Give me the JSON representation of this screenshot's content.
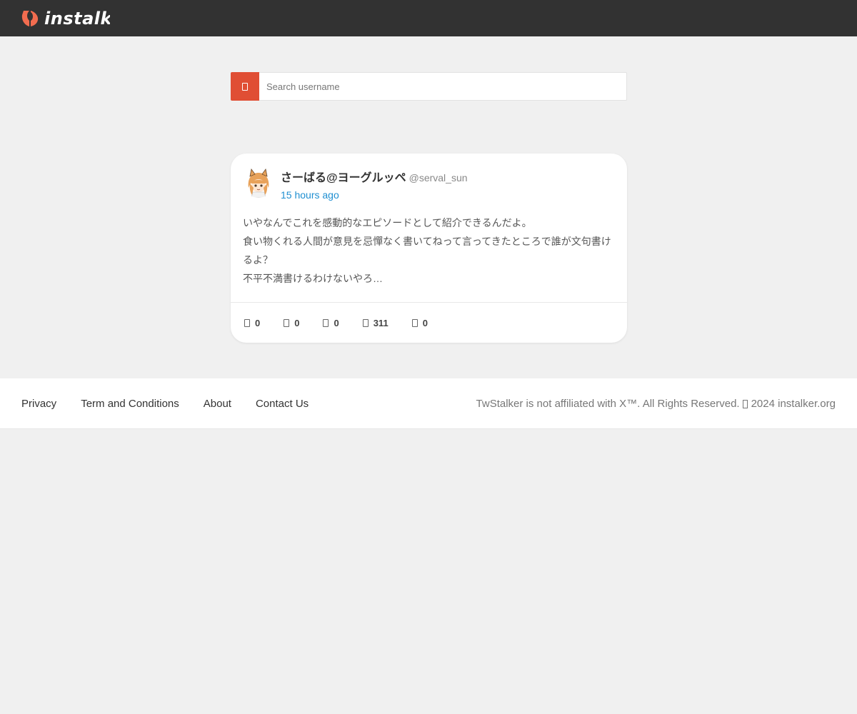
{
  "brand": {
    "name": "instalker",
    "logo_color": "#f26c4f",
    "header_bg": "#323232"
  },
  "search": {
    "placeholder": "Search username",
    "button_icon": "search-icon",
    "button_color": "#e04e34"
  },
  "tweet": {
    "display_name": "さーばる@ヨーグルッペ",
    "handle": "@serval_sun",
    "timestamp": "15 hours ago",
    "lines": [
      "いやなんでこれを感動的なエピソードとして紹介できるんだよ。",
      "食い物くれる人間が意見を忌憚なく書いてねって言ってきたところで誰が文句書け",
      "るよ？",
      "不平不満書けるわけないやろ…"
    ],
    "stats": [
      {
        "icon": "reply-icon",
        "value": "0"
      },
      {
        "icon": "retweet-icon",
        "value": "0"
      },
      {
        "icon": "like-icon",
        "value": "0"
      },
      {
        "icon": "views-icon",
        "value": "311"
      },
      {
        "icon": "bookmark-icon",
        "value": "0"
      }
    ]
  },
  "footer": {
    "links": [
      "Privacy",
      "Term and Conditions",
      "About",
      "Contact Us"
    ],
    "disclaimer": "TwStalker is not affiliated with X™. All Rights Reserved.",
    "copyright_icon": "copyright-icon",
    "year_site": "2024 instalker.org"
  }
}
